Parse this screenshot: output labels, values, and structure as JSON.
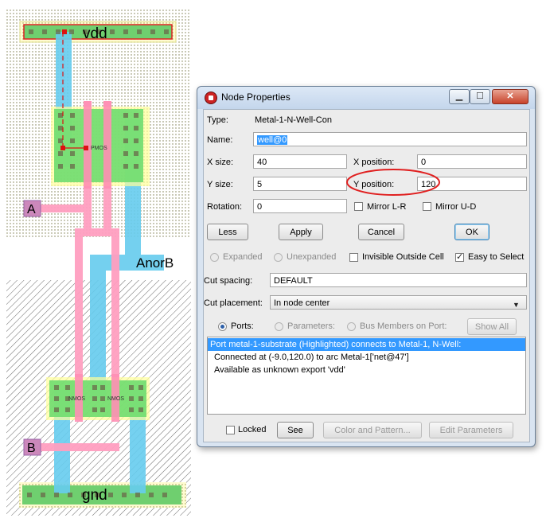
{
  "layout": {
    "vdd_label": "vdd",
    "gnd_label": "gnd",
    "pmos_label": "PMOS",
    "nmos1_label": "NMOS",
    "nmos2_label": "NMOS",
    "a_label": "A",
    "b_label": "B",
    "out_label": "AnorB",
    "colors": {
      "metal1": "#66ccee",
      "poly": "#ff99bb",
      "active": "#66dd66",
      "well_label": "#cc66aa"
    }
  },
  "dialog": {
    "title": "Node Properties",
    "window_buttons": {
      "minimize": "▁",
      "maximize": "☐",
      "close": "✕"
    },
    "type_label": "Type:",
    "type_value": "Metal-1-N-Well-Con",
    "name_label": "Name:",
    "name_value": "well@0",
    "xsize_label": "X size:",
    "xsize_value": "40",
    "xpos_label": "X position:",
    "xpos_value": "0",
    "ysize_label": "Y size:",
    "ysize_value": "5",
    "ypos_label": "Y position:",
    "ypos_value": "120",
    "rotation_label": "Rotation:",
    "rotation_value": "0",
    "mirror_lr": "Mirror L-R",
    "mirror_ud": "Mirror U-D",
    "buttons": {
      "less": "Less",
      "apply": "Apply",
      "cancel": "Cancel",
      "ok": "OK"
    },
    "expanded": "Expanded",
    "unexpanded": "Unexpanded",
    "invisible_outside": "Invisible Outside Cell",
    "easy_to_select": "Easy to Select",
    "cut_spacing_label": "Cut spacing:",
    "cut_spacing_value": "DEFAULT",
    "cut_placement_label": "Cut placement:",
    "cut_placement_value": "In node center",
    "ports_radio": "Ports:",
    "parameters_radio": "Parameters:",
    "bus_members_radio": "Bus Members on Port:",
    "show_all": "Show All",
    "list_items": [
      "Port metal-1-substrate (Highlighted) connects to Metal-1, N-Well:",
      "Connected at (-9.0,120.0) to arc Metal-1['net@47']",
      "Available as unknown export 'vdd'"
    ],
    "locked": "Locked",
    "see": "See",
    "color_pattern": "Color and Pattern...",
    "edit_parameters": "Edit Parameters"
  }
}
